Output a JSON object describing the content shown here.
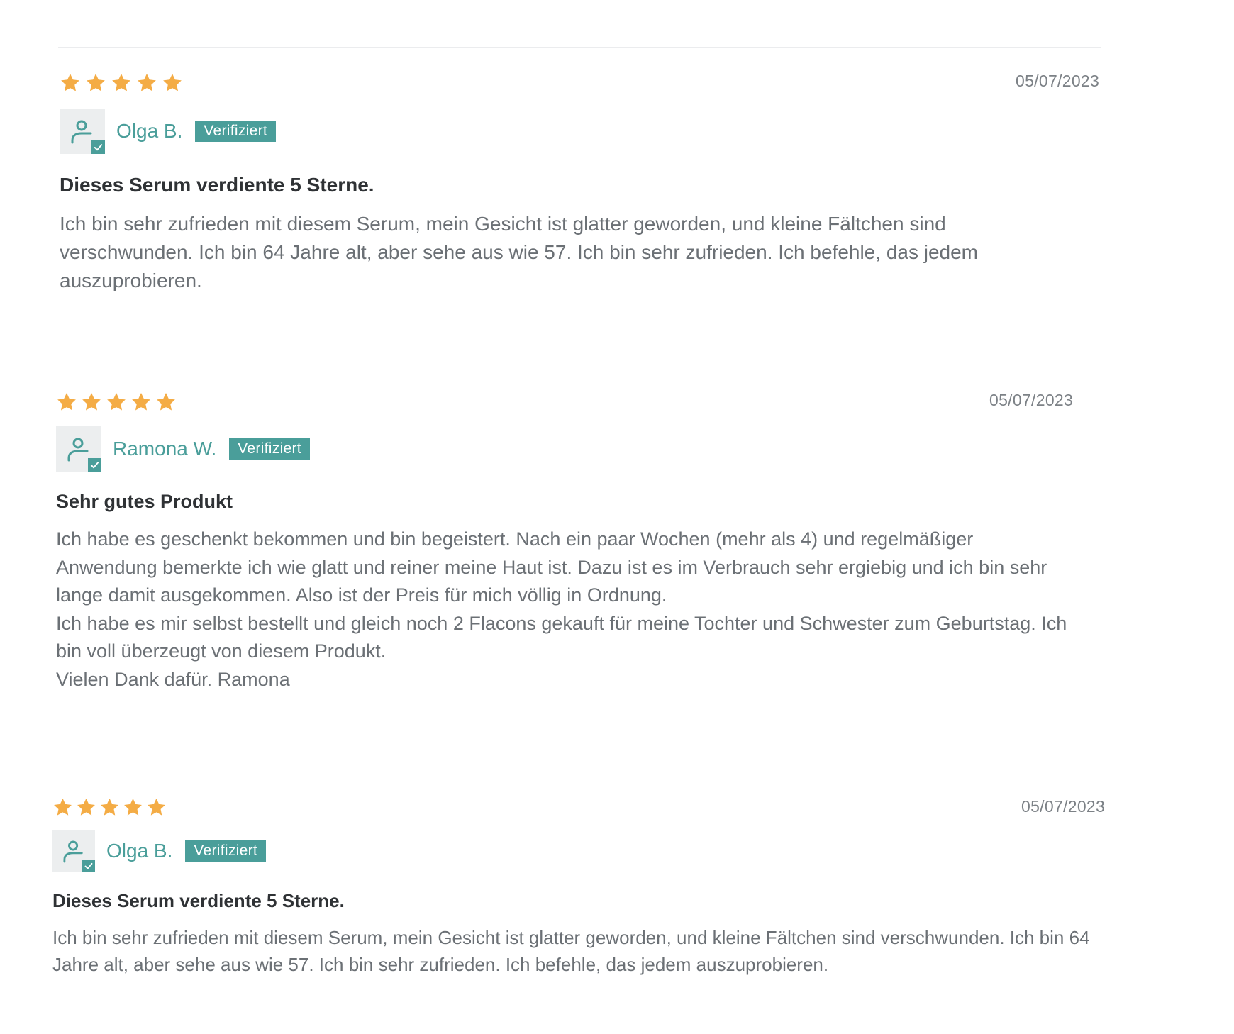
{
  "colors": {
    "accent": "#4a9e9a",
    "star": "#f4ac45",
    "title": "#2f3235",
    "text": "#6b7075",
    "date": "#7c8186"
  },
  "reviews": [
    {
      "rating": 5,
      "date": "05/07/2023",
      "author": "Olga B.",
      "badge": "Verifiziert",
      "avatar_icon": "user-verified-icon",
      "title": "Dieses Serum verdiente 5 Sterne.",
      "body": [
        "Ich bin sehr zufrieden mit diesem Serum, mein Gesicht ist glatter geworden, und kleine Fältchen sind verschwunden. Ich bin 64 Jahre alt, aber sehe aus wie 57. Ich bin sehr zufrieden. Ich befehle, das jedem auszuprobieren."
      ]
    },
    {
      "rating": 5,
      "date": "05/07/2023",
      "author": "Ramona W.",
      "badge": "Verifiziert",
      "avatar_icon": "user-verified-icon",
      "title": "Sehr gutes Produkt",
      "body": [
        "Ich habe es geschenkt bekommen und bin begeistert. Nach ein paar Wochen (mehr als 4) und regelmäßiger Anwendung bemerkte ich wie glatt und reiner meine Haut ist. Dazu ist es im Verbrauch sehr ergiebig und ich bin sehr lange damit ausgekommen. Also ist der Preis für mich völlig in Ordnung.",
        "Ich habe es mir selbst bestellt und gleich noch 2 Flacons gekauft für meine Tochter und Schwester zum Geburtstag. Ich bin voll überzeugt von diesem Produkt.",
        "Vielen Dank dafür. Ramona"
      ]
    },
    {
      "rating": 5,
      "date": "05/07/2023",
      "author": "Olga B.",
      "badge": "Verifiziert",
      "avatar_icon": "user-verified-icon",
      "title": "Dieses Serum verdiente 5 Sterne.",
      "body": [
        "Ich bin sehr zufrieden mit diesem Serum, mein Gesicht ist glatter geworden, und kleine Fältchen sind verschwunden. Ich bin 64 Jahre alt, aber sehe aus wie 57. Ich bin sehr zufrieden. Ich befehle, das jedem auszuprobieren."
      ]
    }
  ]
}
